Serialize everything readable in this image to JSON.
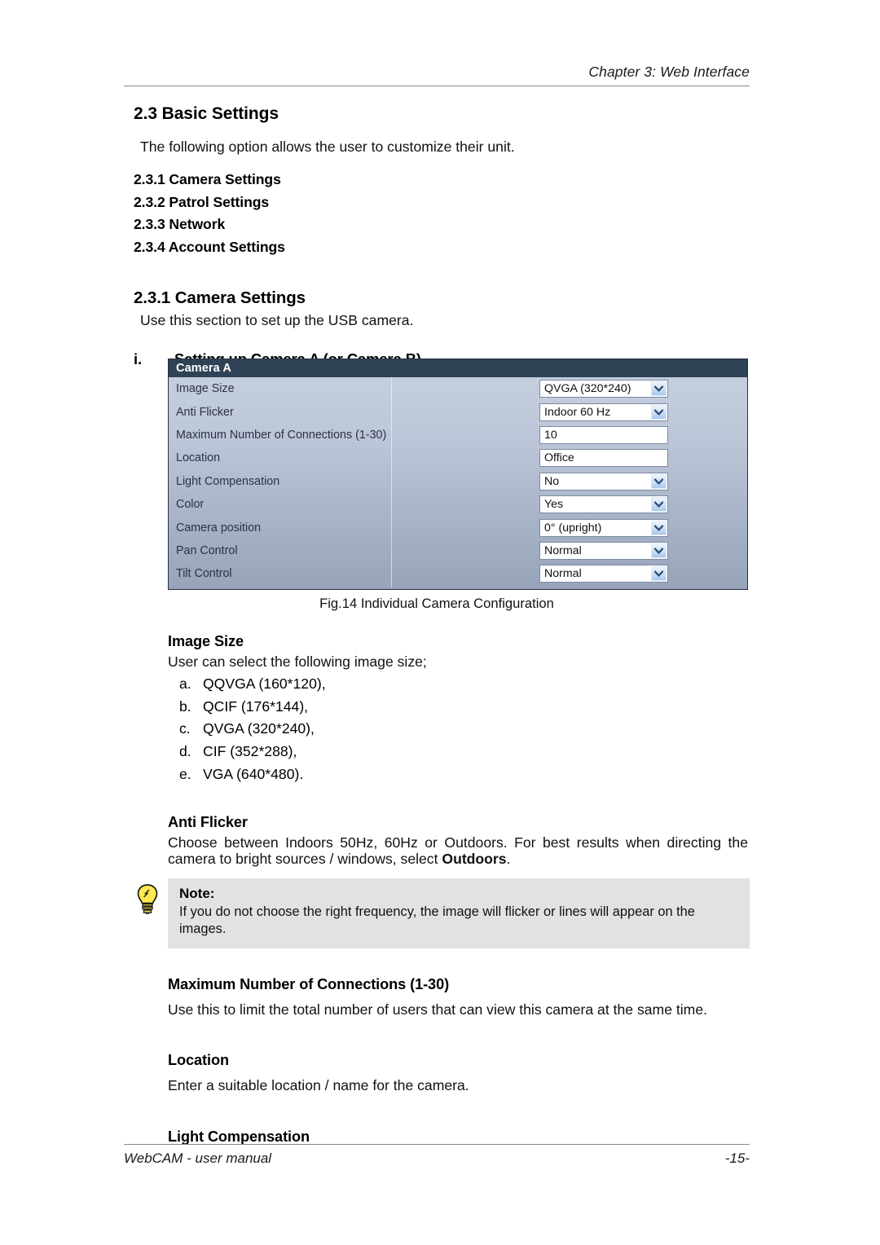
{
  "header": {
    "running_head": "Chapter 3: Web Interface"
  },
  "section": {
    "title": "2.3 Basic Settings",
    "intro": "The following option allows the user to customize their unit.",
    "subsections": [
      "2.3.1 Camera Settings",
      "2.3.2 Patrol Settings",
      "2.3.3 Network",
      "2.3.4 Account Settings"
    ]
  },
  "subsection": {
    "title": "2.3.1 Camera Settings",
    "intro": "Use this section to set up the USB camera.",
    "item_marker": "i.",
    "item_title": "Setting up Camera A (or Camera B)"
  },
  "figure": {
    "caption": "Fig.14  Individual Camera Configuration",
    "panel_title": "Camera A",
    "rows": [
      {
        "label": "Image Size",
        "value": "QVGA (320*240)",
        "control": "select"
      },
      {
        "label": "Anti Flicker",
        "value": "Indoor 60 Hz",
        "control": "select"
      },
      {
        "label": "Maximum Number of Connections (1-30)",
        "value": "10",
        "control": "text"
      },
      {
        "label": "Location",
        "value": "Office",
        "control": "text"
      },
      {
        "label": "Light Compensation",
        "value": "No",
        "control": "select"
      },
      {
        "label": "Color",
        "value": "Yes",
        "control": "select"
      },
      {
        "label": "Camera position",
        "value": "0° (upright)",
        "control": "select"
      },
      {
        "label": "Pan Control",
        "value": "Normal",
        "control": "select"
      },
      {
        "label": "Tilt Control",
        "value": "Normal",
        "control": "select"
      }
    ],
    "colors": {
      "title_bar": "#2f4256",
      "panel_top": "#c7d1e0",
      "panel_bottom": "#97a4ba",
      "field_border": "#7b8aa3",
      "arrow_chevron": "#2b4a77"
    }
  },
  "terms": {
    "image_size": {
      "heading": "Image Size",
      "body": "User can select the following image size;",
      "options": [
        {
          "marker": "a.",
          "text": "QQVGA (160*120),"
        },
        {
          "marker": "b.",
          "text": "QCIF (176*144),"
        },
        {
          "marker": "c.",
          "text": "QVGA (320*240),"
        },
        {
          "marker": "d.",
          "text": "CIF (352*288),"
        },
        {
          "marker": "e.",
          "text": "VGA (640*480)."
        }
      ]
    },
    "anti_flicker": {
      "heading": "Anti Flicker",
      "body_part1": "Choose between Indoors 50Hz, 60Hz or Outdoors.  For best results when directing the camera to bright sources / windows, select ",
      "body_bold": "Outdoors",
      "body_part2": "."
    },
    "note": {
      "icon": "lightbulb-icon",
      "title": "Note:",
      "text": "If you do not choose the right frequency, the image will flicker or lines will appear on the images."
    },
    "max_connections": {
      "heading": "Maximum Number of Connections (1-30)",
      "body": "Use this to limit the total number of users that can view this camera at the same time."
    },
    "location": {
      "heading": "Location",
      "body": "Enter a suitable location / name for the camera."
    },
    "light_compensation": {
      "heading": "Light Compensation"
    }
  },
  "footer": {
    "left": "WebCAM - user manual",
    "right": "-15-"
  }
}
